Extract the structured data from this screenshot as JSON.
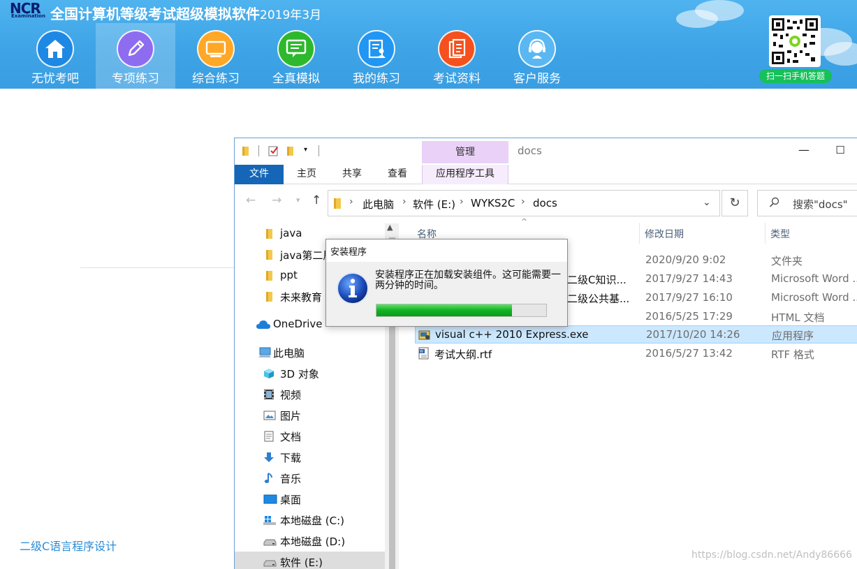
{
  "app": {
    "title": "全国计算机等级考试超级模拟软件",
    "version": "2019年3月",
    "logo_text": "NCR",
    "logo_sub": "Examination",
    "nav": [
      {
        "label": "无忧考吧",
        "icon": "home-icon",
        "active": false
      },
      {
        "label": "专项练习",
        "icon": "pencil-icon",
        "active": true
      },
      {
        "label": "综合练习",
        "icon": "monitor-icon",
        "active": false
      },
      {
        "label": "全真模拟",
        "icon": "chat-screen-icon",
        "active": false
      },
      {
        "label": "我的练习",
        "icon": "user-document-icon",
        "active": false
      },
      {
        "label": "考试资料",
        "icon": "documents-icon",
        "active": false
      },
      {
        "label": "客户服务",
        "icon": "headset-icon",
        "active": false
      }
    ],
    "qr_label": "扫一扫手机答题",
    "colors": {
      "header": "#3ea4e6",
      "nav_home": "#1e88e5",
      "nav_pencil": "#8e6cf0",
      "nav_monitor": "#ffa726",
      "nav_chat": "#2eb82e",
      "nav_user": "#2196f3",
      "nav_docs": "#f4511e",
      "nav_headset": "#5ab7f2",
      "qr_badge": "#16c05a"
    }
  },
  "page": {
    "course_link": "二级C语言程序设计"
  },
  "explorer": {
    "window_title": "docs",
    "tools_tab": "管理",
    "ribbon_tabs": {
      "file": "文件",
      "home": "主页",
      "share": "共享",
      "view": "查看",
      "app_tools": "应用程序工具"
    },
    "breadcrumb": [
      "此电脑",
      "软件 (E:)",
      "WYKS2C",
      "docs"
    ],
    "search_placeholder": "搜索\"docs\"",
    "nav_items": [
      {
        "label": "java",
        "icon": "folder-icon"
      },
      {
        "label": "java第二居",
        "icon": "folder-icon"
      },
      {
        "label": "ppt",
        "icon": "folder-icon"
      },
      {
        "label": "未来教育",
        "icon": "folder-icon"
      },
      {
        "label": "OneDrive",
        "icon": "onedrive-icon"
      },
      {
        "label": "此电脑",
        "icon": "this-pc-icon"
      },
      {
        "label": "3D 对象",
        "icon": "3d-objects-icon"
      },
      {
        "label": "视频",
        "icon": "video-icon"
      },
      {
        "label": "图片",
        "icon": "pictures-icon"
      },
      {
        "label": "文档",
        "icon": "documents-icon"
      },
      {
        "label": "下载",
        "icon": "download-icon"
      },
      {
        "label": "音乐",
        "icon": "music-icon"
      },
      {
        "label": "桌面",
        "icon": "desktop-icon"
      },
      {
        "label": "本地磁盘 (C:)",
        "icon": "windows-drive-icon"
      },
      {
        "label": "本地磁盘 (D:)",
        "icon": "drive-icon"
      },
      {
        "label": "软件 (E:)",
        "icon": "drive-icon"
      }
    ],
    "columns": {
      "name": "名称",
      "date": "修改日期",
      "type": "类型"
    },
    "files": [
      {
        "name": "",
        "date": "2020/9/20 9:02",
        "type": "文件夹"
      },
      {
        "name": "二级C知识...",
        "date": "2017/9/27 14:43",
        "type": "Microsoft Word ..."
      },
      {
        "name": "二级公共基...",
        "date": "2017/9/27 16:10",
        "type": "Microsoft Word ..."
      },
      {
        "name": "",
        "date": "2016/5/25 17:29",
        "type": "HTML 文档"
      },
      {
        "name": "visual c++ 2010 Express.exe",
        "date": "2017/10/20 14:26",
        "type": "应用程序"
      },
      {
        "name": "考试大纲.rtf",
        "date": "2016/5/27 13:42",
        "type": "RTF 格式"
      }
    ]
  },
  "dialog": {
    "title": "安装程序",
    "message": "安装程序正在加载安装组件。这可能需要一两分钟的时间。",
    "progress": 0.8
  },
  "watermark": "https://blog.csdn.net/Andy86666"
}
